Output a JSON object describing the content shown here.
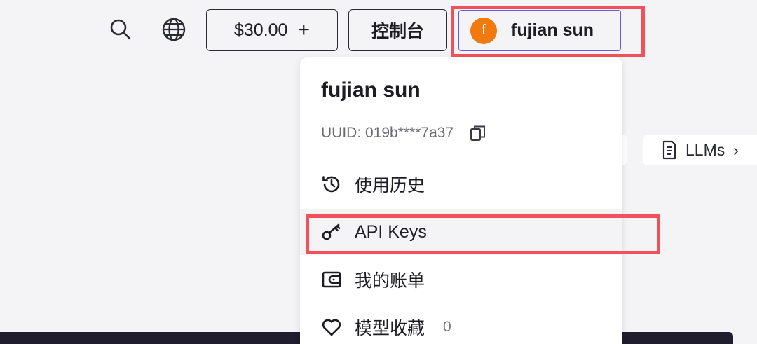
{
  "topbar": {
    "search_icon": "search-icon",
    "language_icon": "globe-icon",
    "balance_label": "$30.00",
    "balance_add_symbol": "+",
    "console_label": "控制台",
    "user": {
      "avatar_initial": "f",
      "avatar_color": "#f07a10",
      "name": "fujian sun"
    }
  },
  "dropdown": {
    "name": "fujian sun",
    "uuid": "UUID: 019b****7a37",
    "items": [
      {
        "label": "使用历史",
        "icon": "history-icon"
      },
      {
        "label": "API Keys",
        "icon": "key-icon"
      },
      {
        "label": "我的账单",
        "icon": "wallet-icon"
      },
      {
        "label": "模型收藏",
        "icon": "heart-icon",
        "count": "0"
      }
    ]
  },
  "background": {
    "llms_label": "LLMs",
    "llms_chevron": "›"
  },
  "colors": {
    "highlight": "#f2515b",
    "focus_border": "#6a5ae0",
    "page_bg": "#f4f4f6"
  }
}
